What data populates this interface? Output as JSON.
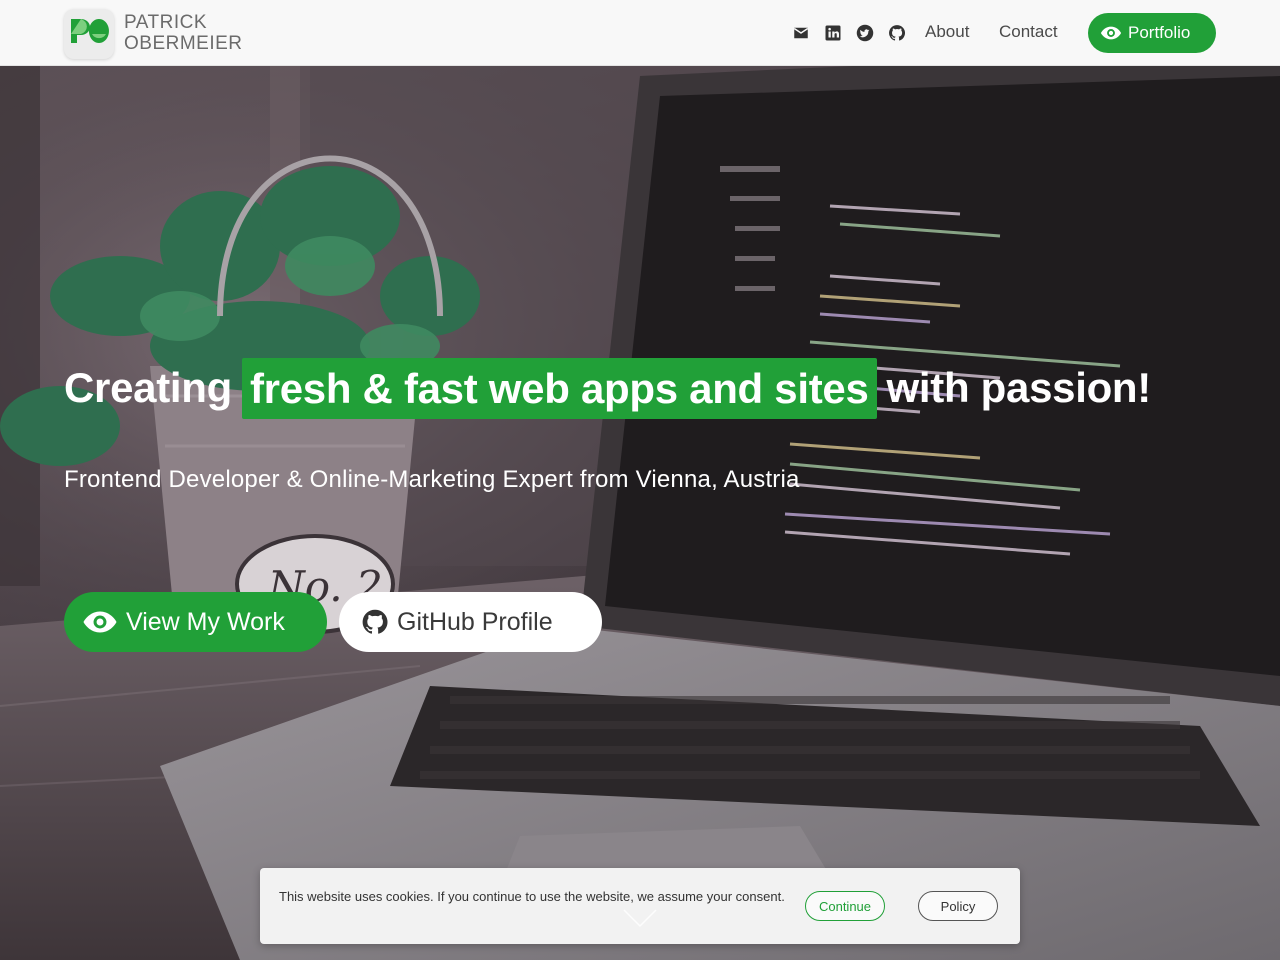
{
  "header": {
    "brand_line1": "PATRICK",
    "brand_line2": "OBERMEIER",
    "social_icons": [
      "mail-icon",
      "linkedin-icon",
      "twitter-icon",
      "github-icon"
    ],
    "nav": {
      "about": "About",
      "contact": "Contact"
    },
    "portfolio_label": "Portfolio"
  },
  "hero": {
    "headline_pre": "Creating",
    "headline_highlight": "fresh & fast web apps and sites",
    "headline_post": "with passion!",
    "subline": "Frontend Developer & Online-Marketing Expert from Vienna, Austria",
    "cta_primary": "View My Work",
    "cta_secondary": "GitHub Profile",
    "pot_label": "No. 2"
  },
  "cookie": {
    "text": "This website uses cookies. If you continue to use the website, we assume your consent.",
    "continue_label": "Continue",
    "policy_label": "Policy"
  },
  "colors": {
    "accent": "#21a038",
    "header_bg": "#f8f8f8",
    "text_light": "#ffffff",
    "cookie_bg": "#f2f2f2"
  }
}
